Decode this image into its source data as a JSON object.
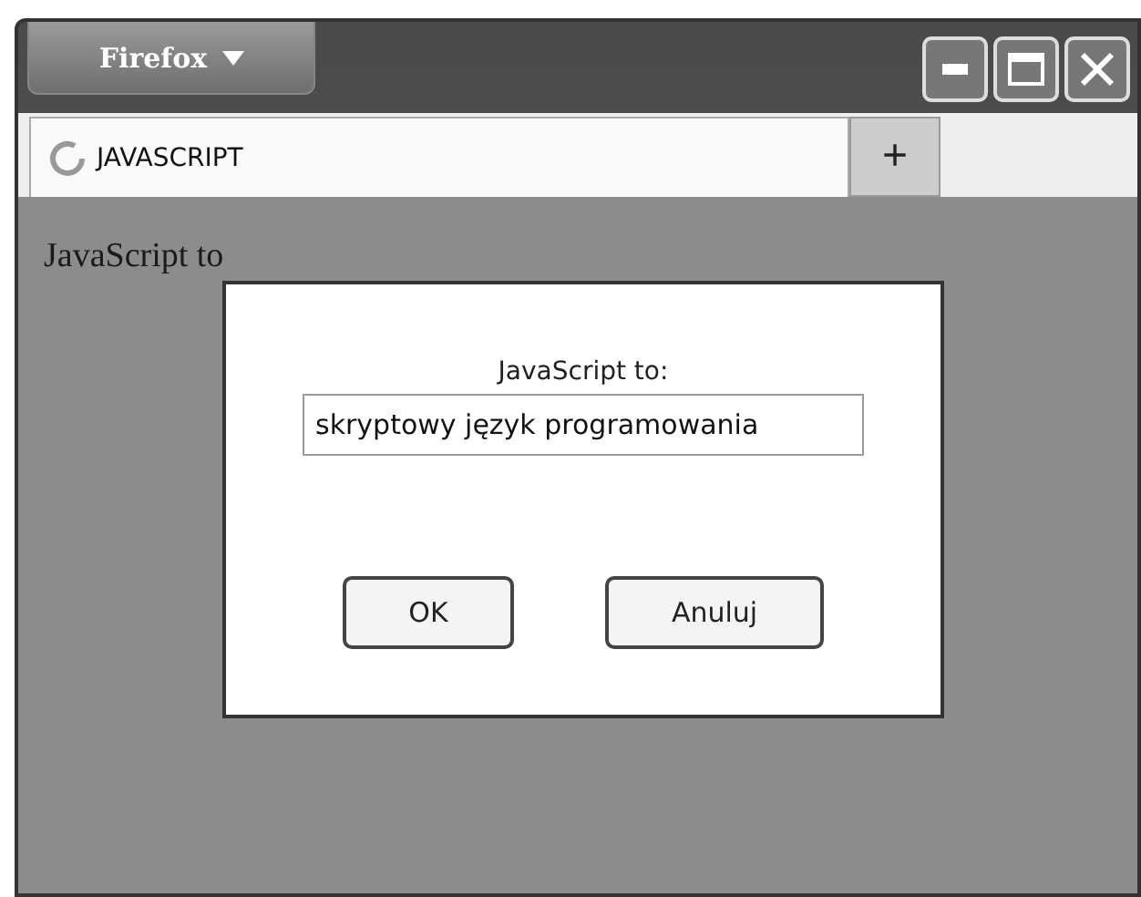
{
  "window": {
    "app_menu": "Firefox"
  },
  "tabs": [
    {
      "label": "JAVASCRIPT",
      "selected": true
    }
  ],
  "new_tab": "+",
  "page": {
    "text": "JavaScript to"
  },
  "dialog": {
    "prompt": "JavaScript to:",
    "value": "skryptowy język programowania",
    "buttons": [
      {
        "label": "OK",
        "selected": false
      },
      {
        "label": "Anuluj",
        "selected": false
      }
    ]
  }
}
